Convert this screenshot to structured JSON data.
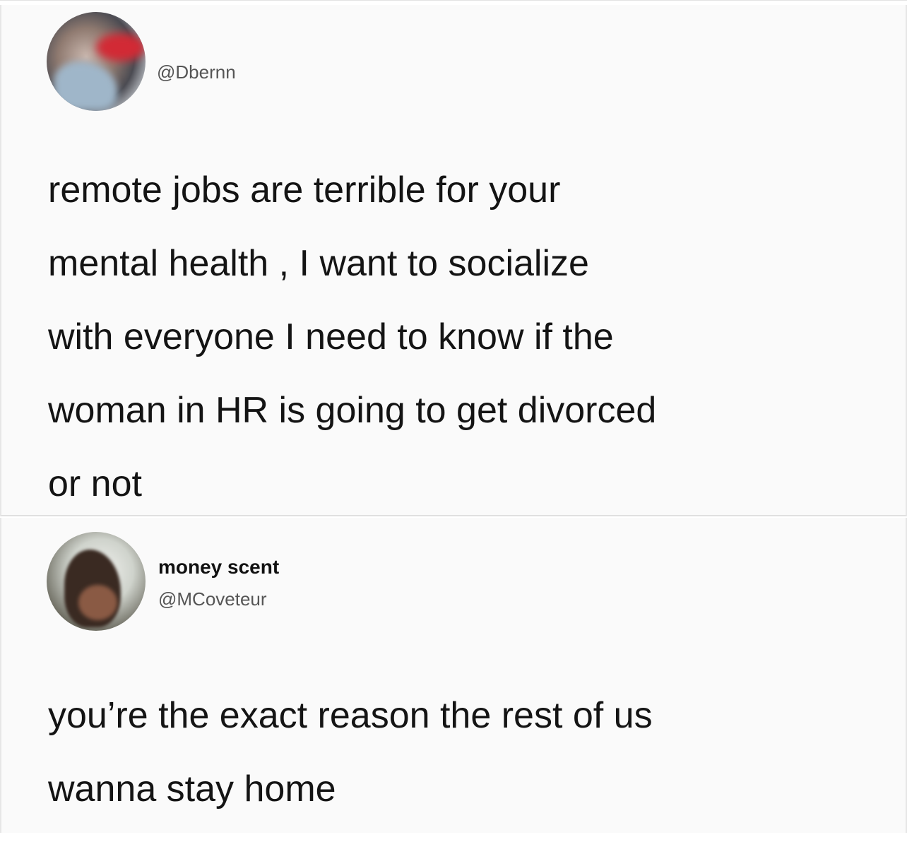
{
  "tweets": [
    {
      "handle": "@Dbernn",
      "text": "remote jobs are terrible for your\nmental health , I want to socialize\nwith everyone I need to know if the\nwoman in HR is going to get divorced\nor not"
    },
    {
      "display_name": "money scent",
      "handle": "@MCoveteur",
      "text": "you’re the exact reason the rest of us\nwanna stay home"
    }
  ]
}
